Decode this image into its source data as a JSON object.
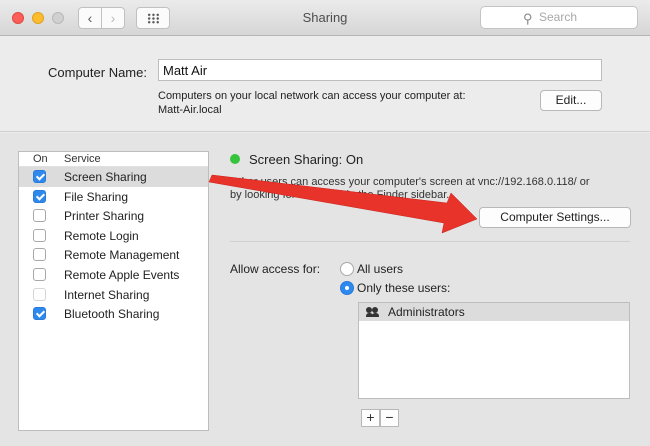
{
  "window": {
    "title": "Sharing",
    "search_placeholder": "Search",
    "back_glyph": "‹",
    "forward_glyph": "›"
  },
  "computer": {
    "label": "Computer Name:",
    "name": "Matt Air",
    "desc_line1": "Computers on your local network can access your computer at:",
    "desc_line2": "Matt-Air.local",
    "edit_label": "Edit..."
  },
  "services": {
    "header_on": "On",
    "header_service": "Service",
    "items": [
      {
        "label": "Screen Sharing",
        "checked": true,
        "selected": true
      },
      {
        "label": "File Sharing",
        "checked": true
      },
      {
        "label": "Printer Sharing",
        "checked": false
      },
      {
        "label": "Remote Login",
        "checked": false
      },
      {
        "label": "Remote Management",
        "checked": false
      },
      {
        "label": "Remote Apple Events",
        "checked": false
      },
      {
        "label": "Internet Sharing",
        "checked": false,
        "dimmed": true
      },
      {
        "label": "Bluetooth Sharing",
        "checked": true
      }
    ]
  },
  "detail": {
    "status_title": "Screen Sharing: On",
    "status_color": "#35c43b",
    "desc_line1": "Other users can access your computer's screen at vnc://192.168.0.118/ or",
    "desc_line2": "by looking for \"Matt Air\" in the Finder sidebar.",
    "computer_settings_label": "Computer Settings...",
    "access_label": "Allow access for:",
    "option_all": "All users",
    "option_only": "Only these users:",
    "selected_option": "only",
    "users": [
      "Administrators"
    ],
    "plus": "+",
    "minus": "−"
  },
  "annotation": {
    "color": "#e8332a",
    "shape": "arrow"
  }
}
